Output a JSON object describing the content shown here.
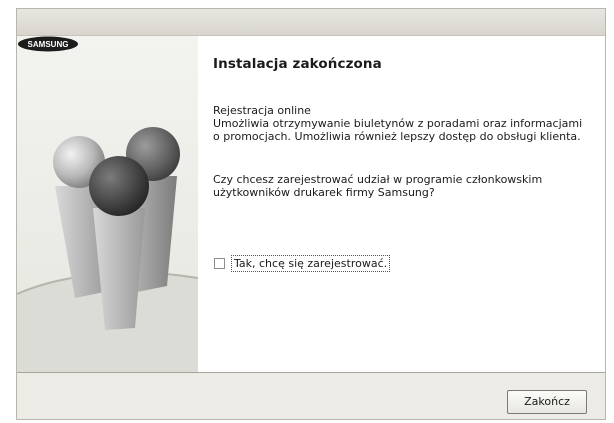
{
  "dialog": {
    "heading": "Instalacja zakończona",
    "registration_title": "Rejestracja online",
    "registration_text": "Umożliwia otrzymywanie biuletynów z poradami oraz informacjami o promocjach. Umożliwia również lepszy dostęp do obsługi klienta.",
    "question": "Czy chcesz zarejestrować udział w programie członkowskim użytkowników drukarek firmy Samsung?",
    "checkbox_label": "Tak, chcę się zarejestrować.",
    "checkbox_checked": false,
    "finish_button": "Zakończ"
  },
  "branding": {
    "logo_text": "SAMSUNG",
    "logo_color": "#1c3d8f"
  },
  "decoration": {
    "sphere_colors": [
      "#7fa23a",
      "#c23a3a",
      "#3a6fc2"
    ]
  }
}
